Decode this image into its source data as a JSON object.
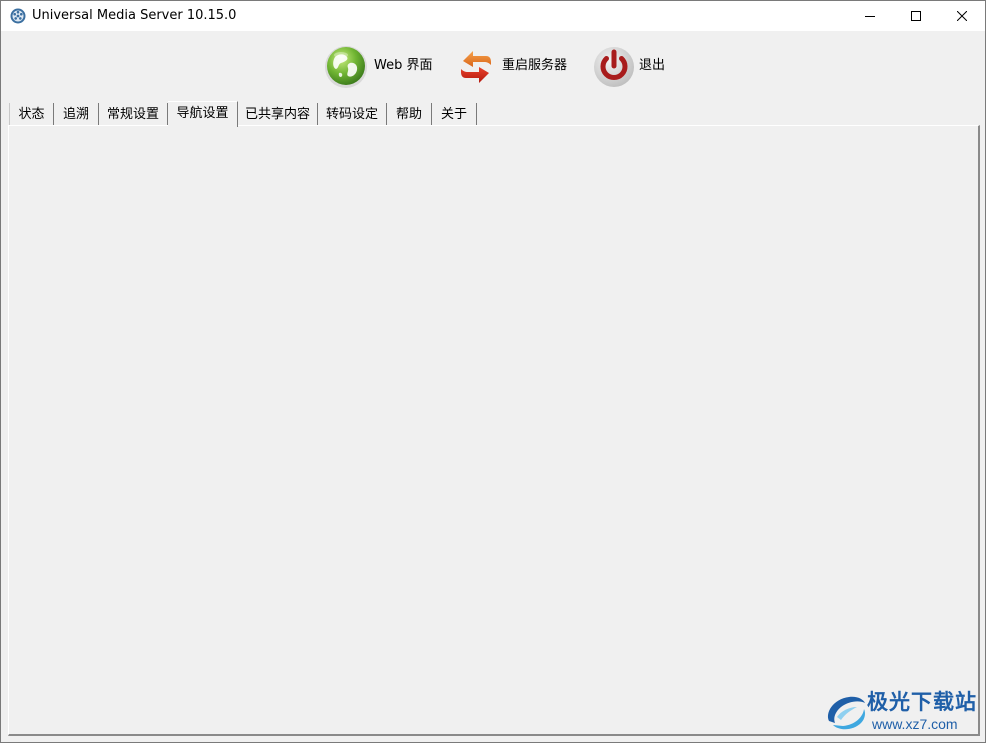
{
  "window": {
    "title": "Universal Media Server 10.15.0",
    "controls": {
      "minimize_icon": "minimize-icon",
      "maximize_icon": "maximize-icon",
      "close_icon": "close-icon"
    }
  },
  "toolbar": {
    "web_label": "Web 界面",
    "web_icon": "globe-icon",
    "restart_label": "重启服务器",
    "restart_icon": "restart-arrows-icon",
    "quit_label": "退出",
    "quit_icon": "power-icon"
  },
  "tabs": [
    {
      "label": "状态",
      "active": false
    },
    {
      "label": "追溯",
      "active": false
    },
    {
      "label": "常规设置",
      "active": false
    },
    {
      "label": "导航设置",
      "active": true
    },
    {
      "label": "已共享内容",
      "active": false
    },
    {
      "label": "转码设定",
      "active": false
    },
    {
      "label": "帮助",
      "active": false
    },
    {
      "label": "关于",
      "active": false
    }
  ],
  "watermark": {
    "name": "极光下载站",
    "url": "www.xz7.com"
  },
  "colors": {
    "window_bg": "#f0f0f0",
    "titlebar_bg": "#ffffff",
    "watermark_blue": "#1f5fa8"
  }
}
